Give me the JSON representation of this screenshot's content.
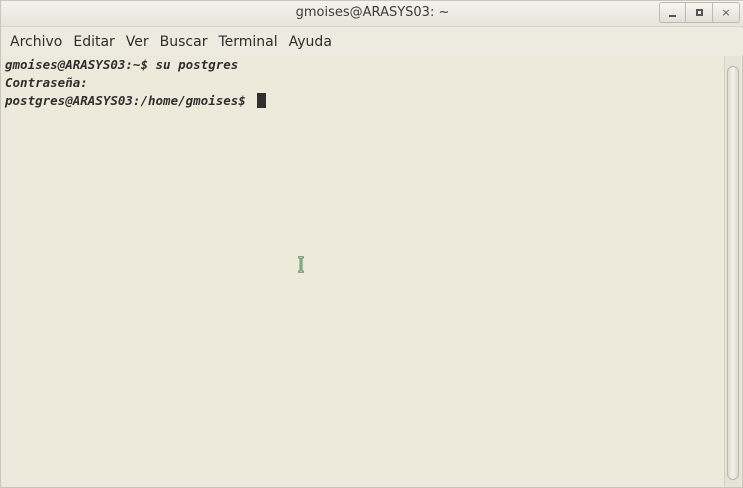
{
  "window": {
    "title": "gmoises@ARASYS03: ~"
  },
  "wm_controls": {
    "close_glyph": "×"
  },
  "menubar": {
    "items": [
      {
        "label": "Archivo"
      },
      {
        "label": "Editar"
      },
      {
        "label": "Ver"
      },
      {
        "label": "Buscar"
      },
      {
        "label": "Terminal"
      },
      {
        "label": "Ayuda"
      }
    ]
  },
  "terminal": {
    "lines": [
      "gmoises@ARASYS03:~$ su postgres",
      "Contraseña:",
      "postgres@ARASYS03:/home/gmoises$ "
    ]
  },
  "icons": {
    "cursor": "i-beam-cursor-icon"
  },
  "colors": {
    "background": "#edeadc",
    "text": "#2f2f2f",
    "ibeam": "#2e7d32"
  }
}
